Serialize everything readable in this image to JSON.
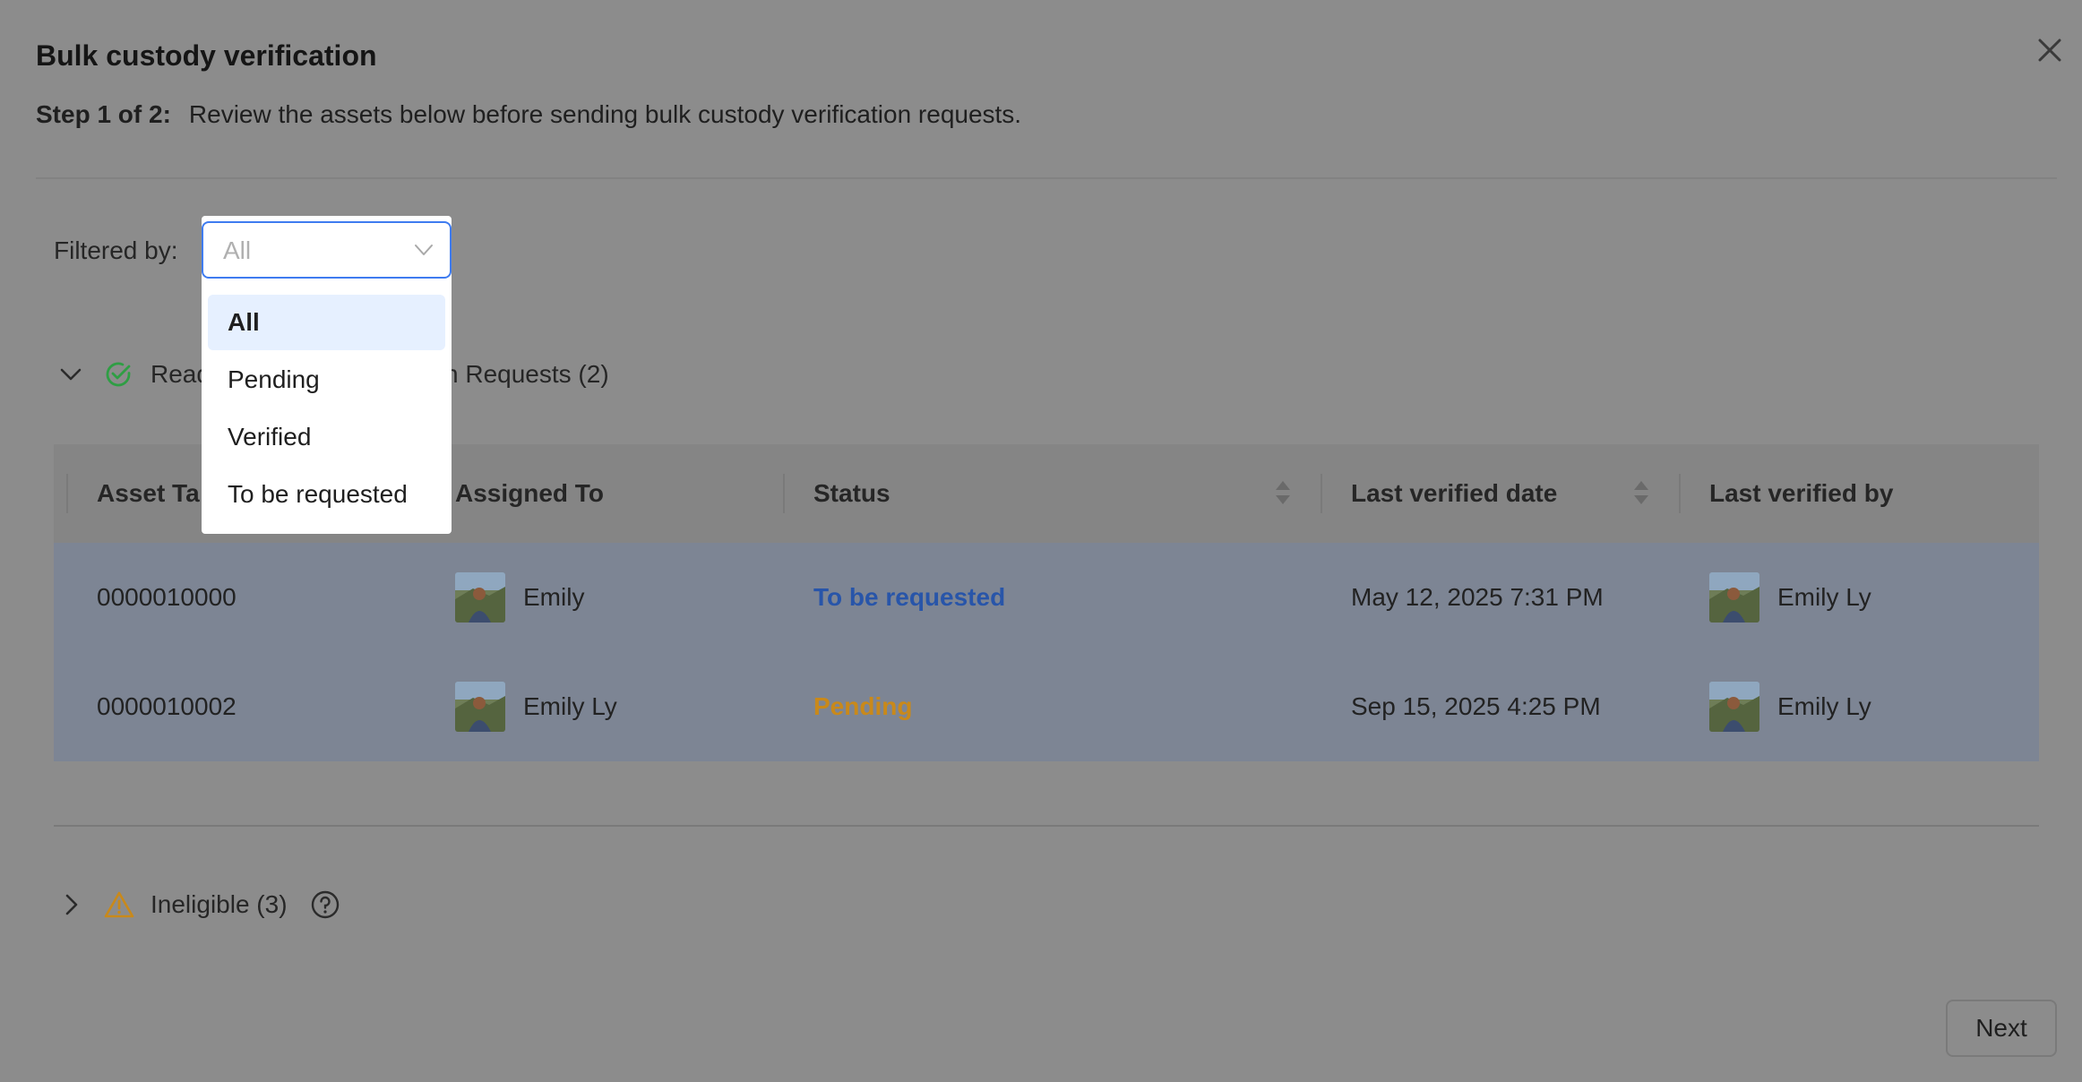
{
  "modal": {
    "title": "Bulk custody verification",
    "step_label": "Step 1 of 2:",
    "step_text": "Review the assets below before sending bulk custody verification requests."
  },
  "filter": {
    "label": "Filtered by:",
    "value": "All",
    "options": [
      "All",
      "Pending",
      "Verified",
      "To be requested"
    ]
  },
  "ready_section": {
    "label_visible_start": "Read",
    "label_visible_end": "n Requests (2)"
  },
  "table": {
    "columns": [
      "Asset Ta",
      "Assigned To",
      "Status",
      "Last verified date",
      "Last verified by"
    ],
    "rows": [
      {
        "asset_tag": "0000010000",
        "assigned_to": "Emily",
        "status": "To be requested",
        "last_verified_date": "May 12, 2025 7:31 PM",
        "last_verified_by": "Emily Ly"
      },
      {
        "asset_tag": "0000010002",
        "assigned_to": "Emily Ly",
        "status": "Pending",
        "last_verified_date": "Sep 15, 2025 4:25 PM",
        "last_verified_by": "Emily Ly"
      }
    ]
  },
  "ineligible_section": {
    "label": "Ineligible (3)"
  },
  "footer": {
    "next_label": "Next"
  },
  "colors": {
    "overlay_bg": "#8c8c8c",
    "accent_blue": "#3f7cf0",
    "status_to_be_requested": "#2855a9",
    "status_pending": "#c9891a",
    "check_green": "#2f9e44",
    "warning_orange": "#c9891a"
  },
  "icons": [
    "close-icon",
    "chevron-down-icon",
    "check-circle-icon",
    "sort-icon",
    "chevron-right-icon",
    "warning-icon",
    "help-icon"
  ]
}
